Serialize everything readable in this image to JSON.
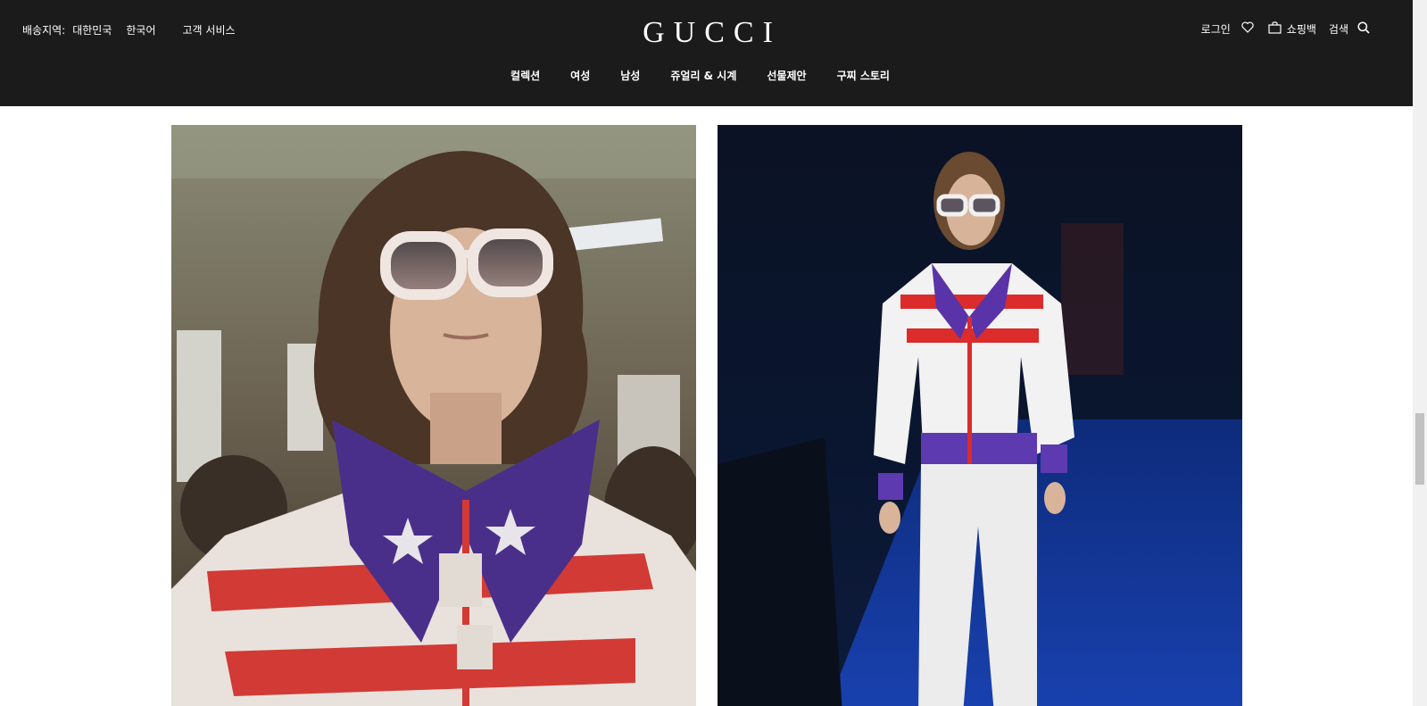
{
  "header": {
    "shipping_label": "배송지역:",
    "shipping_value": "대한민국",
    "language": "한국어",
    "customer_service": "고객 서비스",
    "logo": "GUCCI",
    "login": "로그인",
    "shopping_bag": "쇼핑백",
    "search": "검색"
  },
  "nav": {
    "items": [
      {
        "label": "컬렉션"
      },
      {
        "label": "여성"
      },
      {
        "label": "남성"
      },
      {
        "label": "쥬얼리 & 시계"
      },
      {
        "label": "선물제안"
      },
      {
        "label": "구찌 스토리"
      }
    ]
  },
  "colors": {
    "header_bg": "#1b1b1b",
    "header_text": "#ffffff",
    "page_bg": "#ffffff"
  },
  "icons": {
    "wishlist": "heart-icon",
    "bag": "shopping-bag-icon",
    "search": "search-icon"
  }
}
